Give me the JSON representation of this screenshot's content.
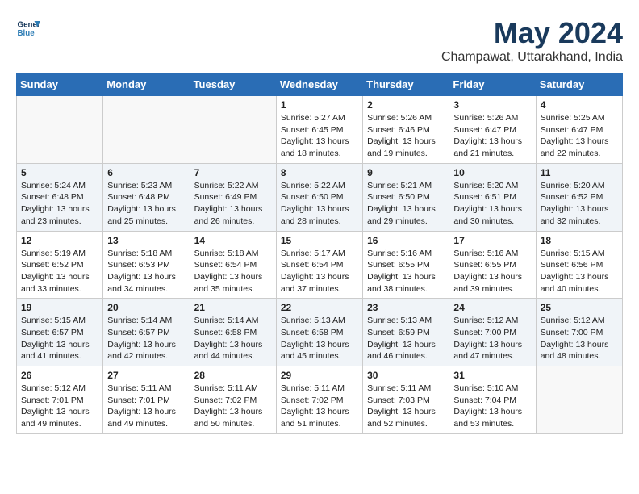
{
  "logo": {
    "line1": "General",
    "line2": "Blue"
  },
  "title": "May 2024",
  "subtitle": "Champawat, Uttarakhand, India",
  "days_of_week": [
    "Sunday",
    "Monday",
    "Tuesday",
    "Wednesday",
    "Thursday",
    "Friday",
    "Saturday"
  ],
  "weeks": [
    [
      {
        "day": "",
        "content": ""
      },
      {
        "day": "",
        "content": ""
      },
      {
        "day": "",
        "content": ""
      },
      {
        "day": "1",
        "content": "Sunrise: 5:27 AM\nSunset: 6:45 PM\nDaylight: 13 hours\nand 18 minutes."
      },
      {
        "day": "2",
        "content": "Sunrise: 5:26 AM\nSunset: 6:46 PM\nDaylight: 13 hours\nand 19 minutes."
      },
      {
        "day": "3",
        "content": "Sunrise: 5:26 AM\nSunset: 6:47 PM\nDaylight: 13 hours\nand 21 minutes."
      },
      {
        "day": "4",
        "content": "Sunrise: 5:25 AM\nSunset: 6:47 PM\nDaylight: 13 hours\nand 22 minutes."
      }
    ],
    [
      {
        "day": "5",
        "content": "Sunrise: 5:24 AM\nSunset: 6:48 PM\nDaylight: 13 hours\nand 23 minutes."
      },
      {
        "day": "6",
        "content": "Sunrise: 5:23 AM\nSunset: 6:48 PM\nDaylight: 13 hours\nand 25 minutes."
      },
      {
        "day": "7",
        "content": "Sunrise: 5:22 AM\nSunset: 6:49 PM\nDaylight: 13 hours\nand 26 minutes."
      },
      {
        "day": "8",
        "content": "Sunrise: 5:22 AM\nSunset: 6:50 PM\nDaylight: 13 hours\nand 28 minutes."
      },
      {
        "day": "9",
        "content": "Sunrise: 5:21 AM\nSunset: 6:50 PM\nDaylight: 13 hours\nand 29 minutes."
      },
      {
        "day": "10",
        "content": "Sunrise: 5:20 AM\nSunset: 6:51 PM\nDaylight: 13 hours\nand 30 minutes."
      },
      {
        "day": "11",
        "content": "Sunrise: 5:20 AM\nSunset: 6:52 PM\nDaylight: 13 hours\nand 32 minutes."
      }
    ],
    [
      {
        "day": "12",
        "content": "Sunrise: 5:19 AM\nSunset: 6:52 PM\nDaylight: 13 hours\nand 33 minutes."
      },
      {
        "day": "13",
        "content": "Sunrise: 5:18 AM\nSunset: 6:53 PM\nDaylight: 13 hours\nand 34 minutes."
      },
      {
        "day": "14",
        "content": "Sunrise: 5:18 AM\nSunset: 6:54 PM\nDaylight: 13 hours\nand 35 minutes."
      },
      {
        "day": "15",
        "content": "Sunrise: 5:17 AM\nSunset: 6:54 PM\nDaylight: 13 hours\nand 37 minutes."
      },
      {
        "day": "16",
        "content": "Sunrise: 5:16 AM\nSunset: 6:55 PM\nDaylight: 13 hours\nand 38 minutes."
      },
      {
        "day": "17",
        "content": "Sunrise: 5:16 AM\nSunset: 6:55 PM\nDaylight: 13 hours\nand 39 minutes."
      },
      {
        "day": "18",
        "content": "Sunrise: 5:15 AM\nSunset: 6:56 PM\nDaylight: 13 hours\nand 40 minutes."
      }
    ],
    [
      {
        "day": "19",
        "content": "Sunrise: 5:15 AM\nSunset: 6:57 PM\nDaylight: 13 hours\nand 41 minutes."
      },
      {
        "day": "20",
        "content": "Sunrise: 5:14 AM\nSunset: 6:57 PM\nDaylight: 13 hours\nand 42 minutes."
      },
      {
        "day": "21",
        "content": "Sunrise: 5:14 AM\nSunset: 6:58 PM\nDaylight: 13 hours\nand 44 minutes."
      },
      {
        "day": "22",
        "content": "Sunrise: 5:13 AM\nSunset: 6:58 PM\nDaylight: 13 hours\nand 45 minutes."
      },
      {
        "day": "23",
        "content": "Sunrise: 5:13 AM\nSunset: 6:59 PM\nDaylight: 13 hours\nand 46 minutes."
      },
      {
        "day": "24",
        "content": "Sunrise: 5:12 AM\nSunset: 7:00 PM\nDaylight: 13 hours\nand 47 minutes."
      },
      {
        "day": "25",
        "content": "Sunrise: 5:12 AM\nSunset: 7:00 PM\nDaylight: 13 hours\nand 48 minutes."
      }
    ],
    [
      {
        "day": "26",
        "content": "Sunrise: 5:12 AM\nSunset: 7:01 PM\nDaylight: 13 hours\nand 49 minutes."
      },
      {
        "day": "27",
        "content": "Sunrise: 5:11 AM\nSunset: 7:01 PM\nDaylight: 13 hours\nand 49 minutes."
      },
      {
        "day": "28",
        "content": "Sunrise: 5:11 AM\nSunset: 7:02 PM\nDaylight: 13 hours\nand 50 minutes."
      },
      {
        "day": "29",
        "content": "Sunrise: 5:11 AM\nSunset: 7:02 PM\nDaylight: 13 hours\nand 51 minutes."
      },
      {
        "day": "30",
        "content": "Sunrise: 5:11 AM\nSunset: 7:03 PM\nDaylight: 13 hours\nand 52 minutes."
      },
      {
        "day": "31",
        "content": "Sunrise: 5:10 AM\nSunset: 7:04 PM\nDaylight: 13 hours\nand 53 minutes."
      },
      {
        "day": "",
        "content": ""
      }
    ]
  ]
}
